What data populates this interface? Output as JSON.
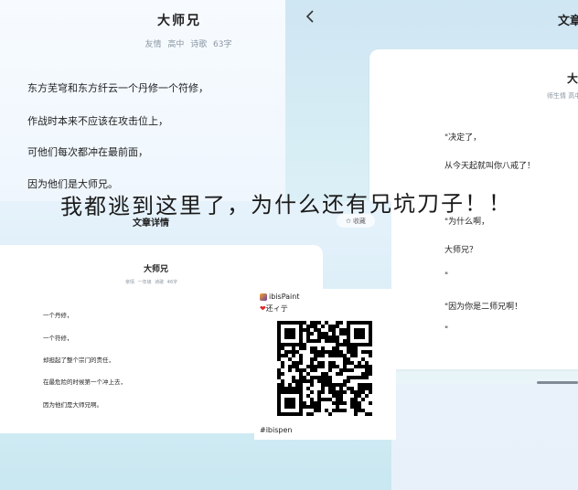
{
  "top_left": {
    "title": "大师兄",
    "meta": "友情   高中   诗歌   63字",
    "lines": [
      "东方芜穹和东方纤云一个丹修一个符修，",
      "作战时本来不应该在攻击位上，",
      "可他们每次都冲在最前面，",
      "因为他们是大师兄。"
    ]
  },
  "right": {
    "back_icon": "chevron-left-icon",
    "header_title": "文章",
    "card_title": "大",
    "card_meta": "师生情   高中",
    "lines": [
      "\"决定了，",
      "从今天起就叫你八戒了！",
      "\"为什么啊，",
      "大师兄？",
      "\"",
      "\"因为你是二师兄啊！",
      "\""
    ]
  },
  "bottom_left": {
    "header_title": "文章详情",
    "collect_icon": "star-icon",
    "collect_label": "收藏",
    "card_title": "大师兄",
    "card_meta": "亲情   一年级   诗歌   46字",
    "lines": [
      "一个丹修，",
      "一个符修，",
      "却担起了整个宗门的责任，",
      "在最危险的时候第一个冲上去，",
      "因为他们是大师兄啊。"
    ]
  },
  "ibis": {
    "app_name": "ibisPaint",
    "user_name": "还ィ亍",
    "heart_icon": "heart-icon",
    "tag": "#ibispen"
  },
  "overlay_caption": "我都逃到这里了，为什么还有兄坑刀子！！",
  "colors": {
    "accent_heart": "#e02828",
    "panel_tint": "#cfe6f3"
  }
}
